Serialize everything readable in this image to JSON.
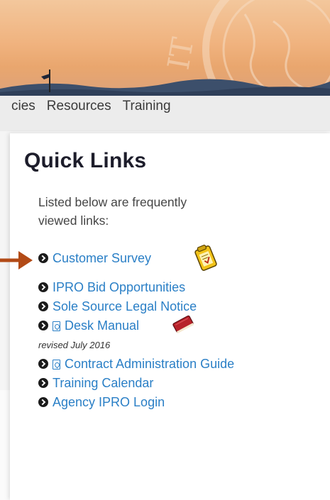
{
  "nav": {
    "items": [
      "cies",
      "Resources",
      "Training"
    ]
  },
  "quick_links": {
    "title": "Quick Links",
    "intro": "Listed below are frequently viewed links:",
    "links": [
      {
        "label": "Customer Survey"
      },
      {
        "label": "IPRO Bid Opportunities"
      },
      {
        "label": "Sole Source Legal Notice"
      },
      {
        "label": "Desk Manual"
      },
      {
        "label": "Contract Administration Guide"
      },
      {
        "label": "Training Calendar"
      },
      {
        "label": "Agency IPRO Login"
      }
    ],
    "revised_note": "revised July 2016"
  },
  "colors": {
    "link": "#2a7fc6",
    "arrow": "#b24a16",
    "heading": "#1d1d2b"
  }
}
